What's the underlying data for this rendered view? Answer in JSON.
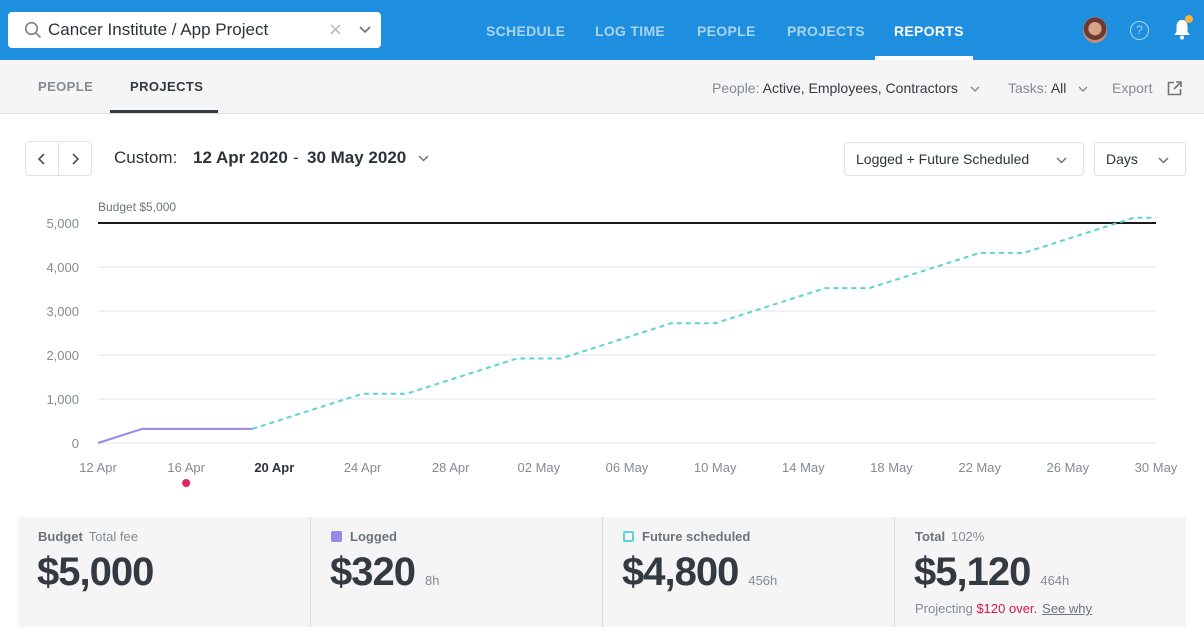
{
  "topbar": {
    "search_value": "Cancer Institute / App Project",
    "nav": [
      {
        "label": "SCHEDULE",
        "active": false
      },
      {
        "label": "LOG TIME",
        "active": false
      },
      {
        "label": "PEOPLE",
        "active": false
      },
      {
        "label": "PROJECTS",
        "active": false
      },
      {
        "label": "REPORTS",
        "active": true
      }
    ],
    "icons": [
      "search-icon",
      "clear-icon",
      "chevron-down-icon",
      "avatar",
      "help-icon",
      "bell-icon"
    ],
    "accent_color": "#1e8fde",
    "notification_dot_color": "#f5b33a"
  },
  "subbar": {
    "tabs": [
      {
        "label": "PEOPLE",
        "active": false
      },
      {
        "label": "PROJECTS",
        "active": true
      }
    ],
    "people_filter_label": "People:",
    "people_filter_value": "Active, Employees, Contractors",
    "tasks_filter_label": "Tasks:",
    "tasks_filter_value": "All",
    "export_label": "Export"
  },
  "toolbar": {
    "range_prefix": "Custom:",
    "range_start": "12 Apr 2020",
    "range_separator": "-",
    "range_end": "30 May 2020",
    "mode_select": "Logged + Future Scheduled",
    "granularity_select": "Days"
  },
  "chart_data": {
    "type": "line",
    "title": "",
    "xlabel": "",
    "ylabel": "",
    "ylim": [
      0,
      5000
    ],
    "yticks": [
      0,
      1000,
      2000,
      3000,
      4000,
      5000
    ],
    "ytick_labels": [
      "0",
      "1,000",
      "2,000",
      "3,000",
      "4,000",
      "5,000"
    ],
    "x_start": "2020-04-12",
    "x_end": "2020-05-30",
    "xtick_labels": [
      "12 Apr",
      "16 Apr",
      "20 Apr",
      "24 Apr",
      "28 Apr",
      "02 May",
      "06 May",
      "10 May",
      "14 May",
      "18 May",
      "22 May",
      "26 May",
      "30 May"
    ],
    "xtick_today": "20 Apr",
    "marker_date_label": "16 Apr",
    "marker_color": "#e0245e",
    "grid": true,
    "budget_line": {
      "label": "Budget $5,000",
      "value": 5000,
      "color": "#1a1a1a"
    },
    "series": [
      {
        "name": "Logged",
        "style": "solid",
        "color": "#9b87e8",
        "points": [
          [
            "12 Apr",
            0
          ],
          [
            "14 Apr",
            320
          ],
          [
            "19 Apr",
            320
          ]
        ]
      },
      {
        "name": "Future scheduled",
        "style": "dashed",
        "color": "#5fd3d3",
        "points": [
          [
            "19 Apr",
            320
          ],
          [
            "24 Apr",
            1120
          ],
          [
            "26 Apr",
            1120
          ],
          [
            "01 May",
            1920
          ],
          [
            "03 May",
            1920
          ],
          [
            "08 May",
            2720
          ],
          [
            "10 May",
            2720
          ],
          [
            "15 May",
            3520
          ],
          [
            "17 May",
            3520
          ],
          [
            "22 May",
            4320
          ],
          [
            "24 May",
            4320
          ],
          [
            "29 May",
            5120
          ],
          [
            "30 May",
            5120
          ]
        ]
      }
    ]
  },
  "summary": {
    "budget": {
      "title": "Budget",
      "subtitle": "Total fee",
      "value": "$5,000"
    },
    "logged": {
      "title": "Logged",
      "value": "$320",
      "hours": "8h",
      "color": "#9b87e8"
    },
    "future": {
      "title": "Future scheduled",
      "value": "$4,800",
      "hours": "456h",
      "color": "#5fd3d3"
    },
    "total": {
      "title": "Total",
      "subtitle": "102%",
      "value": "$5,120",
      "hours": "464h",
      "note_prefix": "Projecting",
      "note_over": "$120 over.",
      "note_link": "See why",
      "over_color": "#d8164f"
    }
  }
}
